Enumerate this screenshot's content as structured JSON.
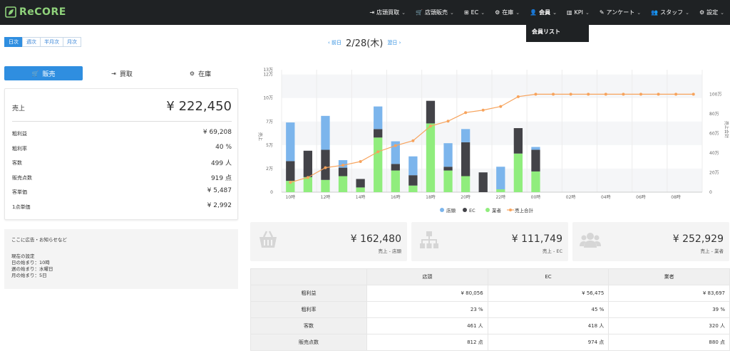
{
  "brand": {
    "name": "ReCORE"
  },
  "nav": [
    {
      "icon": "login-icon",
      "glyph": "⇥",
      "label": "店頭買取",
      "active": false
    },
    {
      "icon": "cart-icon",
      "glyph": "🛒",
      "label": "店頭販売",
      "active": false
    },
    {
      "icon": "sitemap-icon",
      "glyph": "⊞",
      "label": "EC",
      "active": false
    },
    {
      "icon": "boxes-icon",
      "glyph": "⚙",
      "label": "在庫",
      "active": false
    },
    {
      "icon": "user-icon",
      "glyph": "👤",
      "label": "会員",
      "active": true
    },
    {
      "icon": "bar-chart-icon",
      "glyph": "▥",
      "label": "KPI",
      "active": false
    },
    {
      "icon": "edit-icon",
      "glyph": "✎",
      "label": "アンケート",
      "active": false
    },
    {
      "icon": "users-icon",
      "glyph": "👥",
      "label": "スタッフ",
      "active": false
    },
    {
      "icon": "gear-icon",
      "glyph": "⚙",
      "label": "設定",
      "active": false
    }
  ],
  "dropdown": {
    "item": "会員リスト"
  },
  "period_tabs": [
    "日次",
    "週次",
    "半月次",
    "月次"
  ],
  "date_nav": {
    "prev": "‹ 前日",
    "date": "2/28(木)",
    "next": "翌日 ›"
  },
  "mode_tabs": [
    {
      "icon": "cart-icon",
      "glyph": "🛒",
      "label": "販売",
      "active": true
    },
    {
      "icon": "login-icon",
      "glyph": "⇥",
      "label": "買取",
      "active": false
    },
    {
      "icon": "boxes-icon",
      "glyph": "⚙",
      "label": "在庫",
      "active": false
    }
  ],
  "sales": {
    "label": "売上",
    "value": "¥ 222,450",
    "stats": [
      {
        "k": "粗利益",
        "v": "¥ 69,208"
      },
      {
        "k": "粗利率",
        "v": "40 %"
      },
      {
        "k": "客数",
        "v": "499 人"
      },
      {
        "k": "販売点数",
        "v": "919 点"
      },
      {
        "k": "客単価",
        "v": "¥ 5,487"
      },
      {
        "k": "1点単価",
        "v": "¥ 2,992"
      }
    ]
  },
  "notice": {
    "title": "ここに広告・お知らせなど",
    "lines": [
      "現在の設定",
      "日の始まり：10時",
      "週の始まり：水曜日",
      "月の始まり：5日"
    ]
  },
  "chart_data": {
    "type": "bar",
    "stacked": true,
    "x": [
      "10時",
      "11時",
      "12時",
      "13時",
      "14時",
      "15時",
      "16時",
      "17時",
      "18時",
      "19時",
      "20時",
      "21時",
      "22時",
      "23時",
      "00時",
      "01時",
      "02時",
      "03時",
      "04時",
      "05時",
      "06時",
      "07時",
      "08時",
      "09時"
    ],
    "xtick_labels": [
      "10時",
      "12時",
      "14時",
      "16時",
      "18時",
      "20時",
      "22時",
      "00時",
      "02時",
      "04時",
      "06時",
      "08時"
    ],
    "ylabel": "売上",
    "y2label": "売上合計",
    "yticks": [
      "0",
      "2万",
      "5万",
      "7万",
      "10万",
      "12万"
    ],
    "ytick_values": [
      0,
      25000,
      50000,
      75000,
      100000,
      125000
    ],
    "y2ticks": [
      "0",
      "20万",
      "40万",
      "60万",
      "80万",
      "100万"
    ],
    "y2tick_values": [
      0,
      200000,
      400000,
      600000,
      800000,
      1000000
    ],
    "top_tick_label": "13万",
    "ylim": [
      0,
      125000
    ],
    "y2lim": [
      0,
      1000000
    ],
    "grid": true,
    "legend_position": "bottom",
    "series": [
      {
        "name": "業者",
        "kind": "bar",
        "color": "#90ed7d",
        "values": [
          12000,
          16000,
          13000,
          17000,
          5000,
          58000,
          23000,
          7000,
          73000,
          23000,
          17000,
          0,
          3000,
          41000,
          22000,
          0,
          0,
          0,
          0,
          0,
          0,
          0,
          0,
          0
        ]
      },
      {
        "name": "EC",
        "kind": "bar",
        "color": "#434348",
        "values": [
          21000,
          28000,
          32000,
          9000,
          9000,
          9000,
          7000,
          11000,
          24000,
          4000,
          36000,
          21000,
          0,
          27000,
          23000,
          0,
          0,
          0,
          0,
          0,
          0,
          0,
          0,
          0
        ]
      },
      {
        "name": "店頭",
        "kind": "bar",
        "color": "#7cb5ec",
        "values": [
          41000,
          0,
          36000,
          8000,
          0,
          24000,
          24000,
          20000,
          0,
          25000,
          14000,
          0,
          24000,
          0,
          3000,
          0,
          0,
          0,
          0,
          0,
          0,
          0,
          0,
          0
        ]
      },
      {
        "name": "売上合計",
        "kind": "line",
        "axis": "right",
        "color": "#f7a35c",
        "values": [
          80000,
          120000,
          200000,
          220000,
          250000,
          330000,
          380000,
          420000,
          540000,
          580000,
          650000,
          670000,
          700000,
          780000,
          800000,
          800000,
          800000,
          800000,
          800000,
          800000,
          800000,
          800000,
          800000,
          800000
        ]
      }
    ]
  },
  "kpis": [
    {
      "icon": "basket-icon",
      "value": "¥ 162,480",
      "label": "売上 - 店頭"
    },
    {
      "icon": "sitemap-icon",
      "value": "¥ 111,749",
      "label": "売上 - EC"
    },
    {
      "icon": "users-icon",
      "value": "¥ 252,929",
      "label": "売上 - 業者"
    }
  ],
  "table": {
    "headers": [
      "",
      "店頭",
      "EC",
      "業者"
    ],
    "rows": [
      {
        "label": "粗利益",
        "cells": [
          "¥ 80,056",
          "¥ 56,475",
          "¥ 83,697"
        ]
      },
      {
        "label": "粗利率",
        "cells": [
          "23 %",
          "45 %",
          "39 %"
        ]
      },
      {
        "label": "客数",
        "cells": [
          "461 人",
          "418 人",
          "320 人"
        ]
      },
      {
        "label": "販売点数",
        "cells": [
          "812 点",
          "974 点",
          "880 点"
        ]
      }
    ]
  }
}
